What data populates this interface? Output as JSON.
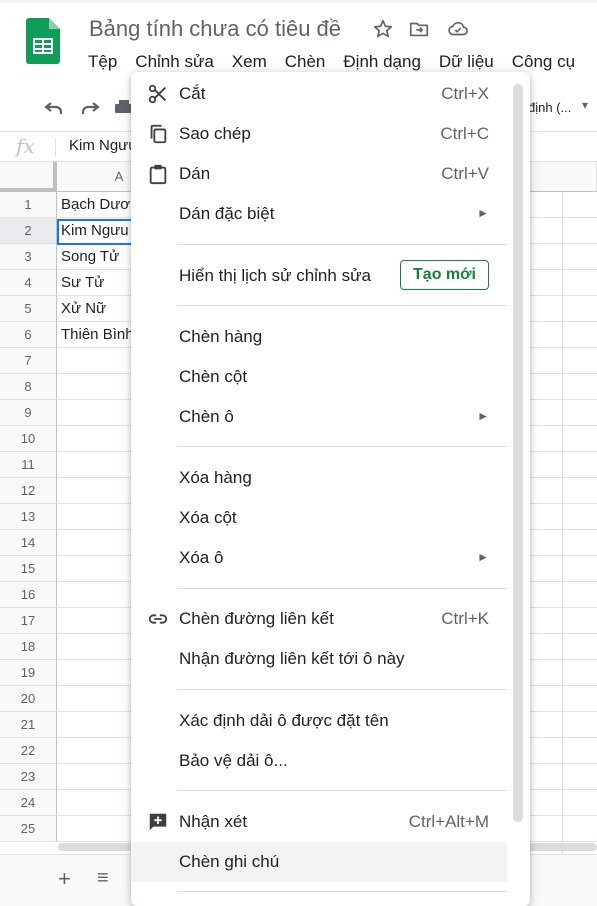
{
  "header": {
    "title": "Bảng tính chưa có tiêu đề",
    "menus": [
      "Tệp",
      "Chỉnh sửa",
      "Xem",
      "Chèn",
      "Định dạng",
      "Dữ liệu",
      "Công cụ"
    ]
  },
  "toolbar": {
    "font_label": "định (...",
    "font_caret": "▾"
  },
  "formula_bar": {
    "fx": "fx",
    "value": "Kim Ngưu"
  },
  "grid": {
    "column_header": "A",
    "row_numbers": [
      "1",
      "2",
      "3",
      "4",
      "5",
      "6",
      "7",
      "8",
      "9",
      "10",
      "11",
      "12",
      "13",
      "14",
      "15",
      "16",
      "17",
      "18",
      "19",
      "20",
      "21",
      "22",
      "23",
      "24",
      "25"
    ],
    "cells": [
      "Bạch Dương",
      "Kim Ngưu",
      "Song Tử",
      "Sư Tử",
      "Xử Nữ",
      "Thiên Bình"
    ]
  },
  "bottom": {
    "add_sheet": "+",
    "sheet_list": "≡"
  },
  "context_menu": {
    "cut": {
      "label": "Cắt",
      "shortcut": "Ctrl+X",
      "icon": "scissors-icon"
    },
    "copy": {
      "label": "Sao chép",
      "shortcut": "Ctrl+C",
      "icon": "copy-icon"
    },
    "paste": {
      "label": "Dán",
      "shortcut": "Ctrl+V",
      "icon": "clipboard-icon"
    },
    "paste_special": {
      "label": "Dán đặc biệt",
      "arrow": "►"
    },
    "edit_history": {
      "label": "Hiển thị lịch sử chỉnh sửa",
      "button": "Tạo mới"
    },
    "insert_row": {
      "label": "Chèn hàng"
    },
    "insert_column": {
      "label": "Chèn cột"
    },
    "insert_cells": {
      "label": "Chèn ô",
      "arrow": "►"
    },
    "delete_row": {
      "label": "Xóa hàng"
    },
    "delete_column": {
      "label": "Xóa cột"
    },
    "delete_cells": {
      "label": "Xóa ô",
      "arrow": "►"
    },
    "insert_link": {
      "label": "Chèn đường liên kết",
      "shortcut": "Ctrl+K",
      "icon": "link-icon"
    },
    "get_link": {
      "label": "Nhận đường liên kết tới ô này"
    },
    "named_range": {
      "label": "Xác định dải ô được đặt tên"
    },
    "protect_range": {
      "label": "Bảo vệ dải ô..."
    },
    "comment": {
      "label": "Nhận xét",
      "shortcut": "Ctrl+Alt+M",
      "icon": "add-comment-icon"
    },
    "insert_note": {
      "label": "Chèn ghi chú"
    }
  },
  "colors": {
    "accent": "#188038",
    "selection": "#1a73e8",
    "sheets_green": "#0f9d58"
  }
}
